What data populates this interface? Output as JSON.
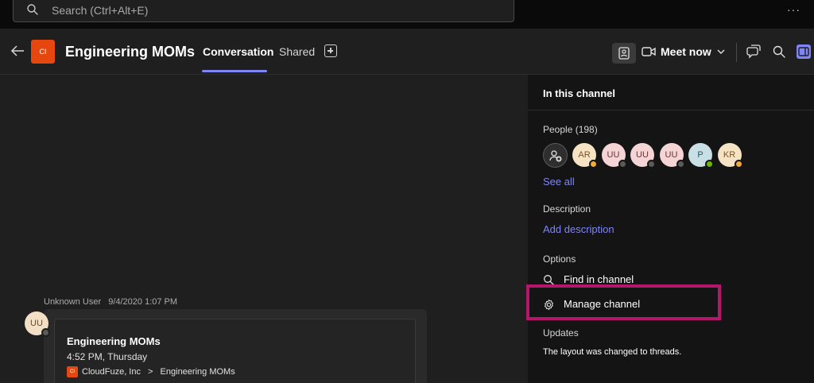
{
  "search": {
    "placeholder": "Search (Ctrl+Alt+E)"
  },
  "header": {
    "team_initials": "CI",
    "channel_title": "Engineering MOMs",
    "tabs": [
      {
        "label": "Conversation",
        "active": true
      },
      {
        "label": "Shared",
        "active": false
      }
    ],
    "meet_now_label": "Meet now",
    "accent_color": "#7f85f5"
  },
  "post": {
    "author": "Unknown User",
    "timestamp": "9/4/2020 1:07 PM",
    "avatar_initials": "UU",
    "card_title": "Engineering MOMs",
    "card_time": "4:52 PM, Thursday",
    "team_icon_text": "CI",
    "breadcrumb_team": "CloudFuze, Inc",
    "breadcrumb_sep": ">",
    "breadcrumb_channel": "Engineering MOMs"
  },
  "panel": {
    "title": "In this channel",
    "people_label": "People (198)",
    "people": [
      {
        "initials": "AR",
        "bg": "#f6e3c4",
        "fg": "#7a5424",
        "status": "away",
        "status_color": "#f2a93b"
      },
      {
        "initials": "UU",
        "bg": "#f5d4d6",
        "fg": "#6b3438",
        "status": "offline",
        "status_color": "#5a5a5a"
      },
      {
        "initials": "UU",
        "bg": "#f5d4d6",
        "fg": "#6b3438",
        "status": "offline",
        "status_color": "#5a5a5a"
      },
      {
        "initials": "UU",
        "bg": "#f5d4d6",
        "fg": "#6b3438",
        "status": "offline",
        "status_color": "#5a5a5a"
      },
      {
        "initials": "P",
        "bg": "#c9dfe6",
        "fg": "#2c5562",
        "status": "available",
        "status_color": "#6bb700"
      },
      {
        "initials": "KR",
        "bg": "#f6e3c4",
        "fg": "#7a5424",
        "status": "away",
        "status_color": "#f2a93b"
      }
    ],
    "see_all": "See all",
    "description_label": "Description",
    "add_description": "Add description",
    "options_label": "Options",
    "find_in_channel": "Find in channel",
    "manage_channel": "Manage channel",
    "updates_label": "Updates",
    "updates_text": "The layout was changed to threads.",
    "highlight_color": "#b4166a"
  }
}
